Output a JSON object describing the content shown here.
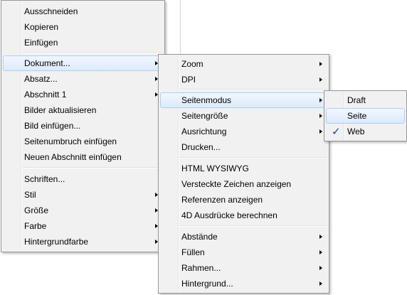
{
  "main_menu": {
    "cut": "Ausschneiden",
    "copy": "Kopieren",
    "paste": "Einfügen",
    "document": "Dokument...",
    "paragraph": "Absatz...",
    "section": "Abschnitt 1",
    "update_images": "Bilder aktualisieren",
    "insert_image": "Bild einfügen...",
    "insert_page_break": "Seitenumbruch einfügen",
    "insert_new_section": "Neuen Abschnitt einfügen",
    "fonts": "Schriften...",
    "style": "Stil",
    "size": "Größe",
    "color": "Farbe",
    "background_color": "Hintergrundfarbe"
  },
  "document_menu": {
    "zoom": "Zoom",
    "dpi": "DPI",
    "page_mode": "Seitenmodus",
    "page_size": "Seitengröße",
    "orientation": "Ausrichtung",
    "print": "Drucken...",
    "html_wysiwyg": "HTML WYSIWYG",
    "hidden_chars": "Versteckte Zeichen anzeigen",
    "show_references": "Referenzen anzeigen",
    "compute_4d": "4D Ausdrücke berechnen",
    "spacing": "Abstände",
    "fill": "Füllen",
    "borders": "Rahmen...",
    "background": "Hintergrund..."
  },
  "page_mode_menu": {
    "draft": "Draft",
    "page": "Seite",
    "web": "Web",
    "checked_item": "Web"
  },
  "icons": {
    "check": "✓"
  },
  "colors": {
    "highlight_border": "#aecff7",
    "check": "#1c3f95"
  }
}
